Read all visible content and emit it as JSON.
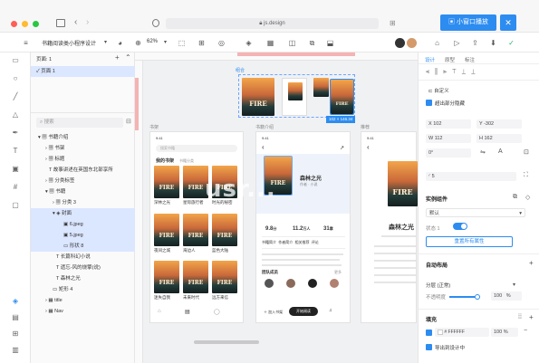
{
  "browser": {
    "url": "js.design",
    "overlay_button": "小窗口播放",
    "accent": "#2d8cf0"
  },
  "toolbar": {
    "project_name": "书籍阅读类小程序设计",
    "zoom": "62%"
  },
  "layers": {
    "pages_title": "页面: 1",
    "page_1": "页面 1",
    "search_placeholder": "搜索",
    "items": [
      "书籍介绍",
      "书架",
      "标题",
      "故事讲述在英国东北部享所",
      "分类标签",
      "书籍",
      "分类 3",
      "封面",
      "6.jpeg",
      "5.jpeg",
      "形状 8",
      "长篇科幻小说",
      "遗忘-风的烧擎(说)",
      "森林之光",
      "矩形 4",
      "title",
      "Nav"
    ]
  },
  "canvas": {
    "selection_label": "组合",
    "size_badge": "102 × 146.34",
    "frame_labels": [
      "书架",
      "书籍介绍",
      "推荐"
    ],
    "book_title": "森林之光",
    "book_cover_text": "FIRE",
    "watermark": "usr..."
  },
  "shelf": {
    "search": "搜索书籍",
    "tab": "我的书架",
    "tab2": "书籍分类",
    "captions": [
      "深林之光",
      "星际旅行者",
      "时光的秘密",
      "夜间之城",
      "海边人",
      "蓝色大陆",
      "迷失自我",
      "未来时代",
      "远方来信"
    ]
  },
  "detail": {
    "title": "森林之光",
    "subtitle": "作者 · 小说",
    "stats": [
      {
        "value": "9.8",
        "unit": "分"
      },
      {
        "value": "11.2",
        "unit": "万人"
      },
      {
        "value": "31",
        "unit": "章"
      }
    ],
    "tabs": [
      "书籍简介",
      "作者简介",
      "相关推荐",
      "评论"
    ],
    "section": "团队成员",
    "more": "更多",
    "read_button": "开始阅读",
    "add_button": "加入书架"
  },
  "right_panel": {
    "tabs": [
      "设计",
      "原型",
      "标注"
    ],
    "position_mode": "自定义",
    "clip_label": "超出部分隐藏",
    "x": "X  102",
    "y": "Y  -302",
    "w": "W  112",
    "h": "H  162",
    "rotation": "0°",
    "radius": "5",
    "instance_title": "实例组件",
    "instance_name": "默认",
    "toggle_label": "状态 1",
    "reset_button": "重置所有属性",
    "layout_title": "自动布局",
    "layout_mode": "分层 (正常)",
    "opacity_label": "不透明度",
    "opacity_value": "100",
    "opacity_unit": "%",
    "fill_title": "填充",
    "fill_hex": "# FFFFFF",
    "fill_opacity": "100",
    "fill_unit": "%",
    "export_label": "导出到设计中",
    "toggle_on": true
  }
}
